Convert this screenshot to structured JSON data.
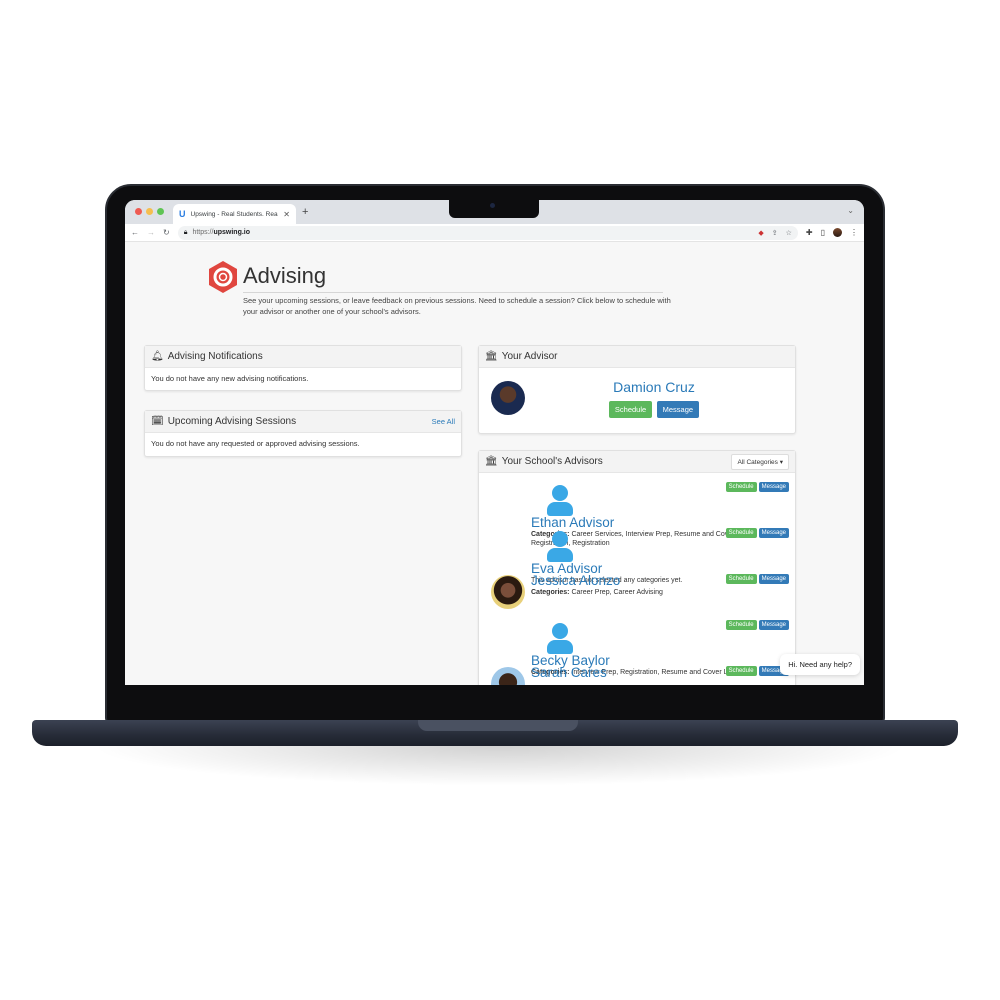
{
  "browser": {
    "tab_title": "Upswing - Real Students. Real",
    "tab_logo": "U",
    "url_proto": "https://",
    "url_host": "upswing.io",
    "new_tab": "+",
    "tab_close": "✕",
    "icons": [
      "back-icon",
      "forward-icon",
      "reload-icon",
      "lock-icon",
      "extension-icon",
      "share-icon",
      "star-icon",
      "puzzle-icon",
      "sidebar-icon",
      "profile-avatar",
      "menu-icon"
    ]
  },
  "page": {
    "title": "Advising",
    "description": "See your upcoming sessions, or leave feedback on previous sessions. Need to schedule a session? Click below to schedule with your advisor or another one of your school's advisors.",
    "brand_color": "#e0463f"
  },
  "notifications": {
    "title": "Advising Notifications",
    "empty": "You do not have any new advising notifications."
  },
  "sessions": {
    "title": "Upcoming Advising Sessions",
    "see_all": "See All",
    "empty": "You do not have any requested or approved advising sessions."
  },
  "your_advisor": {
    "title": "Your Advisor",
    "name": "Damion Cruz",
    "schedule": "Schedule",
    "message": "Message"
  },
  "school_advisors": {
    "title": "Your School's Advisors",
    "filter": "All Categories ▾",
    "schedule": "Schedule",
    "message": "Message",
    "categories_label": "Categories:",
    "items": [
      {
        "name": "Ethan Advisor",
        "categories": "Career Services, Interview Prep, Resume and Cover Letter, Registration, Registration",
        "avatar": "default"
      },
      {
        "name": "Eva Advisor",
        "note": "This advisor has not selected any categories yet.",
        "avatar": "default"
      },
      {
        "name": "Jessica Alonzo",
        "categories": "Career Prep, Career Advising",
        "avatar": "photo"
      },
      {
        "name": "Becky Baylor",
        "categories": "Interview Prep, Registration, Resume and Cover Letter",
        "avatar": "default"
      },
      {
        "name": "Sarah Cares",
        "avatar": "photo"
      }
    ]
  },
  "chat": {
    "prompt": "Hi. Need any help?"
  },
  "colors": {
    "link": "#2a7ab8",
    "schedule_green": "#5cb85c",
    "message_blue": "#337ab7",
    "avatar_blue": "#3aa8e6"
  }
}
